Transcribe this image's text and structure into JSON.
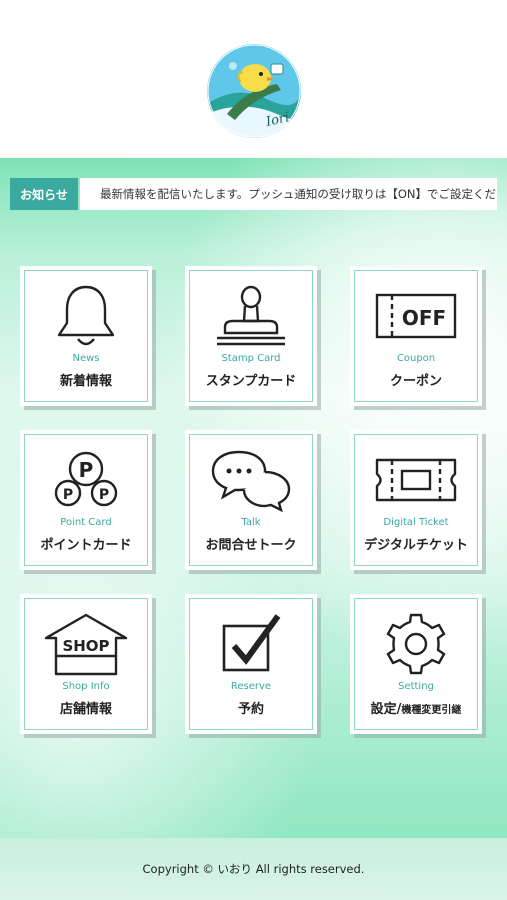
{
  "logo": {
    "text": "Iori",
    "icon": "chick-logo-icon"
  },
  "news_bar": {
    "label": "お知らせ",
    "text": "最新情報を配信いたします。プッシュ通知の受け取りは【ON】でご設定ください。"
  },
  "menu": [
    {
      "en": "News",
      "jp": "新着情報",
      "icon": "bell-icon"
    },
    {
      "en": "Stamp Card",
      "jp": "スタンプカード",
      "icon": "stamp-icon"
    },
    {
      "en": "Coupon",
      "jp": "クーポン",
      "icon": "coupon-off-icon",
      "icon_text": "OFF"
    },
    {
      "en": "Point Card",
      "jp": "ポイントカード",
      "icon": "point-coins-icon",
      "icon_text": "P"
    },
    {
      "en": "Talk",
      "jp": "お問合せトーク",
      "icon": "chat-bubbles-icon"
    },
    {
      "en": "Digital Ticket",
      "jp": "デジタルチケット",
      "icon": "ticket-icon"
    },
    {
      "en": "Shop Info",
      "jp": "店舗情報",
      "icon": "shop-icon",
      "icon_text": "SHOP"
    },
    {
      "en": "Reserve",
      "jp": "予約",
      "icon": "checkbox-icon"
    },
    {
      "en": "Setting",
      "jp": "設定/",
      "jp_small": "機種変更引継",
      "icon": "gear-icon"
    }
  ],
  "footer": {
    "copyright": "Copyright © いおり All rights reserved."
  },
  "colors": {
    "accent": "#3aa9a0",
    "tile_border": "#8fd6c3",
    "mint": "#7ee3b6"
  }
}
